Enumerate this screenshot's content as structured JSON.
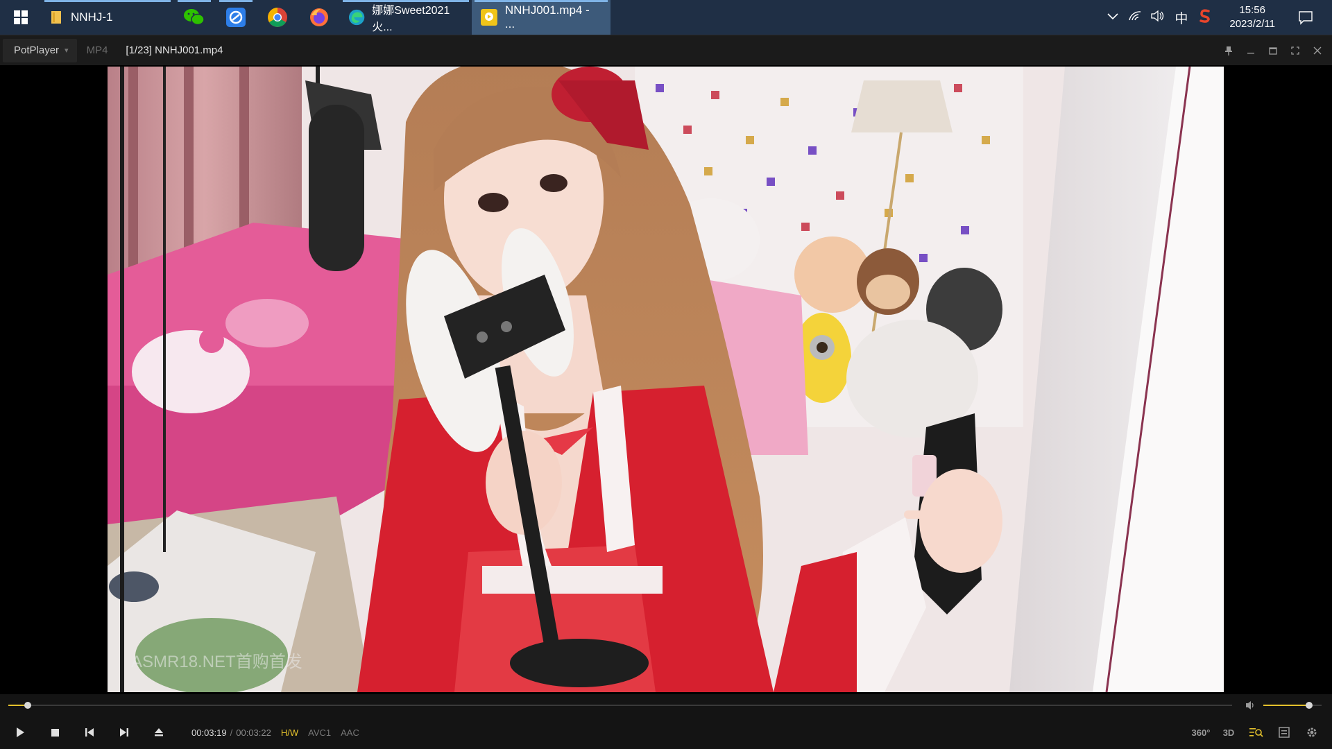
{
  "taskbar": {
    "items": [
      {
        "label": "NNHJ-1",
        "icon": "folder-icon"
      },
      {
        "icon": "wechat-icon"
      },
      {
        "icon": "browser-blue-icon"
      },
      {
        "icon": "chrome-icon"
      },
      {
        "icon": "firefox-icon"
      },
      {
        "label": "娜娜Sweet2021火...",
        "icon": "edge-icon"
      },
      {
        "label": "NNHJ001.mp4 - ...",
        "icon": "potplayer-icon"
      }
    ],
    "tray": {
      "ime": "中",
      "time": "15:56",
      "date": "2023/2/11"
    }
  },
  "player": {
    "brand": "PotPlayer",
    "format": "MP4",
    "title": "[1/23] NNHJ001.mp4",
    "watermark": "ASMR18.NET首购首发"
  },
  "playback": {
    "current": "00:03:19",
    "separator": "/",
    "duration": "00:03:22",
    "progress": 0.016,
    "volume": 0.78,
    "tags": [
      "H/W",
      "AVC1",
      "AAC"
    ],
    "right_buttons": [
      "360°",
      "3D"
    ]
  },
  "colors": {
    "accent": "#e4c12c",
    "taskbar": "#1f2f45"
  }
}
